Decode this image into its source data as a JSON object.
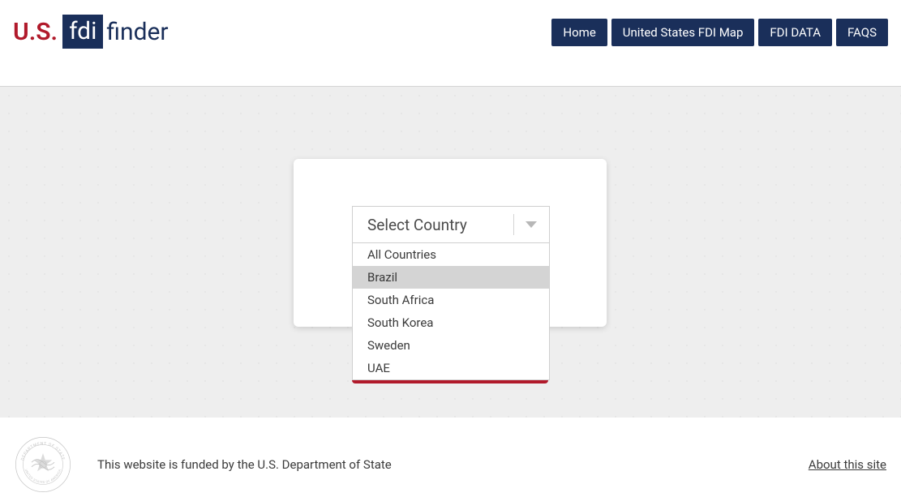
{
  "logo": {
    "us": "U.S.",
    "fdi": "fdi",
    "finder": "finder"
  },
  "nav": {
    "items": [
      "Home",
      "United States FDI Map",
      "FDI DATA",
      "FAQS"
    ]
  },
  "select": {
    "placeholder": "Select Country",
    "options": [
      {
        "label": "All Countries",
        "hover": false
      },
      {
        "label": "Brazil",
        "hover": true
      },
      {
        "label": "South Africa",
        "hover": false
      },
      {
        "label": "South Korea",
        "hover": false
      },
      {
        "label": "Sweden",
        "hover": false
      },
      {
        "label": "UAE",
        "hover": false
      }
    ]
  },
  "footer": {
    "funding": "This website is funded by the U.S. Department of State",
    "about": "About this site"
  }
}
